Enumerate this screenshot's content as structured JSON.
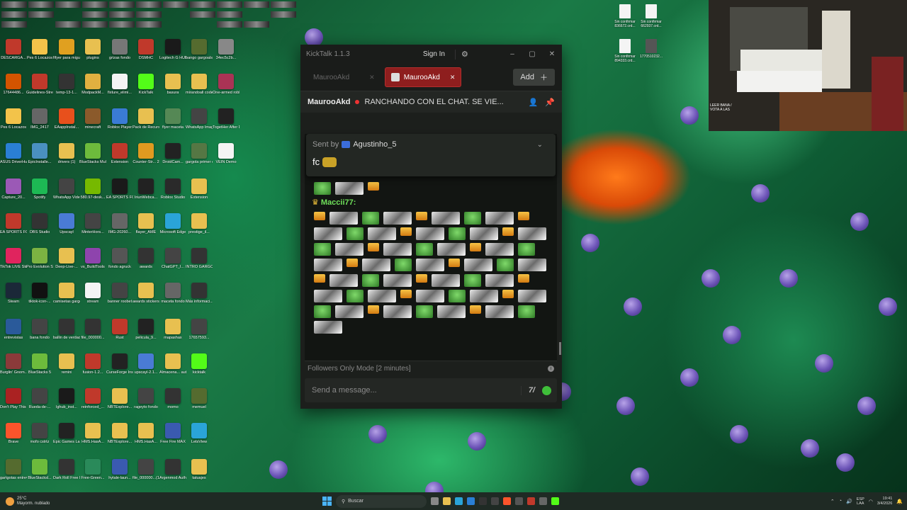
{
  "desktop": {
    "icons": [
      {
        "label": "DESCARGA...",
        "color": "#c0392b"
      },
      {
        "label": "Pes 6 Locazos",
        "color": "#f3c34a"
      },
      {
        "label": "fifyer para miguel",
        "color": "#e0a020"
      },
      {
        "label": "plugins",
        "color": "#e8c050"
      },
      {
        "label": "grizas fondo",
        "color": "#777777"
      },
      {
        "label": "DSMHC",
        "color": "#c0392b"
      },
      {
        "label": "Logitech G HUB",
        "color": "#1a1a1a"
      },
      {
        "label": "bango gargoals",
        "color": "#556b2f"
      },
      {
        "label": "34ec5c2b...",
        "color": "#888888"
      },
      {
        "label": "17644486...",
        "color": "#d35400"
      },
      {
        "label": "Guidelines-Streams",
        "color": "#c0392b"
      },
      {
        "label": "temp-13-1...",
        "color": "#333333"
      },
      {
        "label": "ModpackM...",
        "color": "#e0b040"
      },
      {
        "label": "fixture_elimi...",
        "color": "#f4f4f4"
      },
      {
        "label": "KickTalk",
        "color": "#53fc18"
      },
      {
        "label": "basura",
        "color": "#e8c050"
      },
      {
        "label": "mirandoall code",
        "color": "#e8c050"
      },
      {
        "label": "One-armed robber",
        "color": "#aa3355"
      },
      {
        "label": "Pes 6 Locazos",
        "color": "#f3c34a"
      },
      {
        "label": "IMG_2417",
        "color": "#666666"
      },
      {
        "label": "EAappInstal...",
        "color": "#e8501c"
      },
      {
        "label": "minecraft",
        "color": "#8b5a2b"
      },
      {
        "label": "Roblox Player",
        "color": "#3a7bd5"
      },
      {
        "label": "Pack de Recursos -...",
        "color": "#e8c050"
      },
      {
        "label": "flyer maceta",
        "color": "#558855"
      },
      {
        "label": "WhatsApp Image 2026...",
        "color": "#444444"
      },
      {
        "label": "TogetHer After Dark",
        "color": "#222222"
      },
      {
        "label": "ASUS DriverHub",
        "color": "#2a7fd4"
      },
      {
        "label": "EpicInstalle...",
        "color": "#4a90c0"
      },
      {
        "label": "drivers (1)",
        "color": "#e8c050"
      },
      {
        "label": "BlueStacks Multi-Instan...",
        "color": "#6dbb3c"
      },
      {
        "label": "Extension",
        "color": "#c0392b"
      },
      {
        "label": "Counter-Str... 2",
        "color": "#e09a20"
      },
      {
        "label": "DroidCam...",
        "color": "#222222"
      },
      {
        "label": "gargola primer e...",
        "color": "#557744"
      },
      {
        "label": "VEIN Demo",
        "color": "#f4f4f4"
      },
      {
        "label": "Capture_20...",
        "color": "#9b59b6"
      },
      {
        "label": "Spotify",
        "color": "#1db954"
      },
      {
        "label": "WhatsApp Video 2025...",
        "color": "#444444"
      },
      {
        "label": "580.97-desk...",
        "color": "#76b900"
      },
      {
        "label": "EA SPORTS FC™ 26",
        "color": "#1a1a1a"
      },
      {
        "label": "IriunWebca...",
        "color": "#222222"
      },
      {
        "label": "Roblox Studio",
        "color": "#2a2a2a"
      },
      {
        "label": "Extension",
        "color": "#e8c050"
      },
      {
        "label": "EA SPORTS FC 26",
        "color": "#c0392b"
      },
      {
        "label": "OBS Studio",
        "color": "#333333"
      },
      {
        "label": "Upscayl",
        "color": "#4a7bd5"
      },
      {
        "label": "MinterHors...",
        "color": "#444444"
      },
      {
        "label": "IMG-20260...",
        "color": "#666666"
      },
      {
        "label": "flayer_AME",
        "color": "#e8c050"
      },
      {
        "label": "Microsoft Edge",
        "color": "#2aa4d8"
      },
      {
        "label": "prestige_il...",
        "color": "#e8c050"
      },
      {
        "label": "TikTok LIVE Studio",
        "color": "#e0245e"
      },
      {
        "label": "Pro Evolution Soccer 6",
        "color": "#7cb342"
      },
      {
        "label": "Deep-Live-...",
        "color": "#e8c050"
      },
      {
        "label": "vs_BuildTools",
        "color": "#8e44ad"
      },
      {
        "label": "fondo agruck",
        "color": "#555555"
      },
      {
        "label": "awards",
        "color": "#333333"
      },
      {
        "label": "ChatGPT_I...",
        "color": "#444444"
      },
      {
        "label": "INTRO GARGO...",
        "color": "#333333"
      },
      {
        "label": "Steam",
        "color": "#1b2838"
      },
      {
        "label": "tiktok-icon-...",
        "color": "#111111"
      },
      {
        "label": "camisetas gargolas",
        "color": "#e8c050"
      },
      {
        "label": "stream",
        "color": "#f4f4f4"
      },
      {
        "label": "banner roobet",
        "color": "#444444"
      },
      {
        "label": "awards stickers...",
        "color": "#e8c050"
      },
      {
        "label": "maceta fondo",
        "color": "#666666"
      },
      {
        "label": "Más informaci...",
        "color": "#333333"
      },
      {
        "label": "entrevistas",
        "color": "#2a5a9a"
      },
      {
        "label": "bana fondo",
        "color": "#444444"
      },
      {
        "label": "ballin de verdad",
        "color": "#333333"
      },
      {
        "label": "file_000000...",
        "color": "#333333"
      },
      {
        "label": "Rust",
        "color": "#c0392b"
      },
      {
        "label": "pelicula_9...",
        "color": "#222222"
      },
      {
        "label": "mapashax",
        "color": "#e8c050"
      },
      {
        "label": "17657593...",
        "color": "#444444"
      },
      {
        "label": "Burglin' Gnom...",
        "color": "#8b3a3a"
      },
      {
        "label": "BlueStacks 5",
        "color": "#6dbb3c"
      },
      {
        "label": "remini",
        "color": "#e8c050"
      },
      {
        "label": "fusion-1.2...",
        "color": "#c0392b"
      },
      {
        "label": "CurseForge Installer",
        "color": "#222222"
      },
      {
        "label": "upscayl-2.1...",
        "color": "#4a7bd5"
      },
      {
        "label": "Almacena... automatic...",
        "color": "#e8c050"
      },
      {
        "label": "kicktalk",
        "color": "#53fc18"
      },
      {
        "label": "Don't Play This Demo",
        "color": "#aa2222"
      },
      {
        "label": "Rueda-de-...",
        "color": "#444444"
      },
      {
        "label": "lghub_inst...",
        "color": "#1a1a1a"
      },
      {
        "label": "reinforced_...",
        "color": "#c0392b"
      },
      {
        "label": "NBTExplore...",
        "color": "#e8c050"
      },
      {
        "label": "rageyto fondo",
        "color": "#444444"
      },
      {
        "label": "momo",
        "color": "#333333"
      },
      {
        "label": "memuel",
        "color": "#556b2f"
      },
      {
        "label": "Brave",
        "color": "#fb542b"
      },
      {
        "label": "mofo cstrtz",
        "color": "#444444"
      },
      {
        "label": "Epic Games Launcher",
        "color": "#222222"
      },
      {
        "label": "HMS.HasA...",
        "color": "#e8c050"
      },
      {
        "label": "NBTExplore...",
        "color": "#e8c050"
      },
      {
        "label": "HMS.HasA...",
        "color": "#e8c050"
      },
      {
        "label": "Free Fire MAX",
        "color": "#3a5ab0"
      },
      {
        "label": "LetsView",
        "color": "#2aa4d8"
      },
      {
        "label": "gartgotas entrevistas",
        "color": "#556b2f"
      },
      {
        "label": "BlueStacksl...",
        "color": "#6dbb3c"
      },
      {
        "label": "Dark Roll Free Kic...",
        "color": "#333333"
      },
      {
        "label": "Free-Green...",
        "color": "#2a8a5a"
      },
      {
        "label": "hytale-laun...",
        "color": "#3a5ab0"
      },
      {
        "label": "file_000000...(1)",
        "color": "#444444"
      },
      {
        "label": "Argenmod Auth",
        "color": "#333333"
      },
      {
        "label": "tatuajes",
        "color": "#e8c050"
      }
    ],
    "right_files": [
      {
        "label": "Sin confirmar 836672.crd..."
      },
      {
        "label": "Sin confirmar 662937.crd..."
      },
      {
        "label": "Sin confirmar 894333.crd..."
      },
      {
        "label": "1770510232..."
      }
    ],
    "webcam_overlay_text": "LEER BANA / VOTA A LAS"
  },
  "kicktalk": {
    "app_title": "KickTalk 1.1.3",
    "sign_in": "Sign In",
    "tabs": [
      {
        "label": "MaurooAkd",
        "active": false
      },
      {
        "label": "MaurooAkd",
        "active": true
      }
    ],
    "add_label": "Add",
    "stream": {
      "channel": "MaurooAkd",
      "title": "RANCHANDO CON EL CHAT. SE VIE..."
    },
    "pinned": {
      "sent_by": "Sent by",
      "user": "Agustinho_5",
      "message": "fc"
    },
    "chat_user": "Maccii77:",
    "mode_text": "Followers Only Mode [2 minutes]",
    "input_placeholder": "Send a message...",
    "colors": {
      "accent": "#53fc18",
      "tab_active": "#8e1e1e",
      "bg": "#1c1f1c"
    }
  },
  "taskbar": {
    "weather_temp": "25°C",
    "weather_desc": "Mayorm. nublado",
    "search_placeholder": "Buscar",
    "lang_top": "ESP",
    "lang_bottom": "LAA",
    "time": "19:41",
    "date": "3/4/2026"
  }
}
